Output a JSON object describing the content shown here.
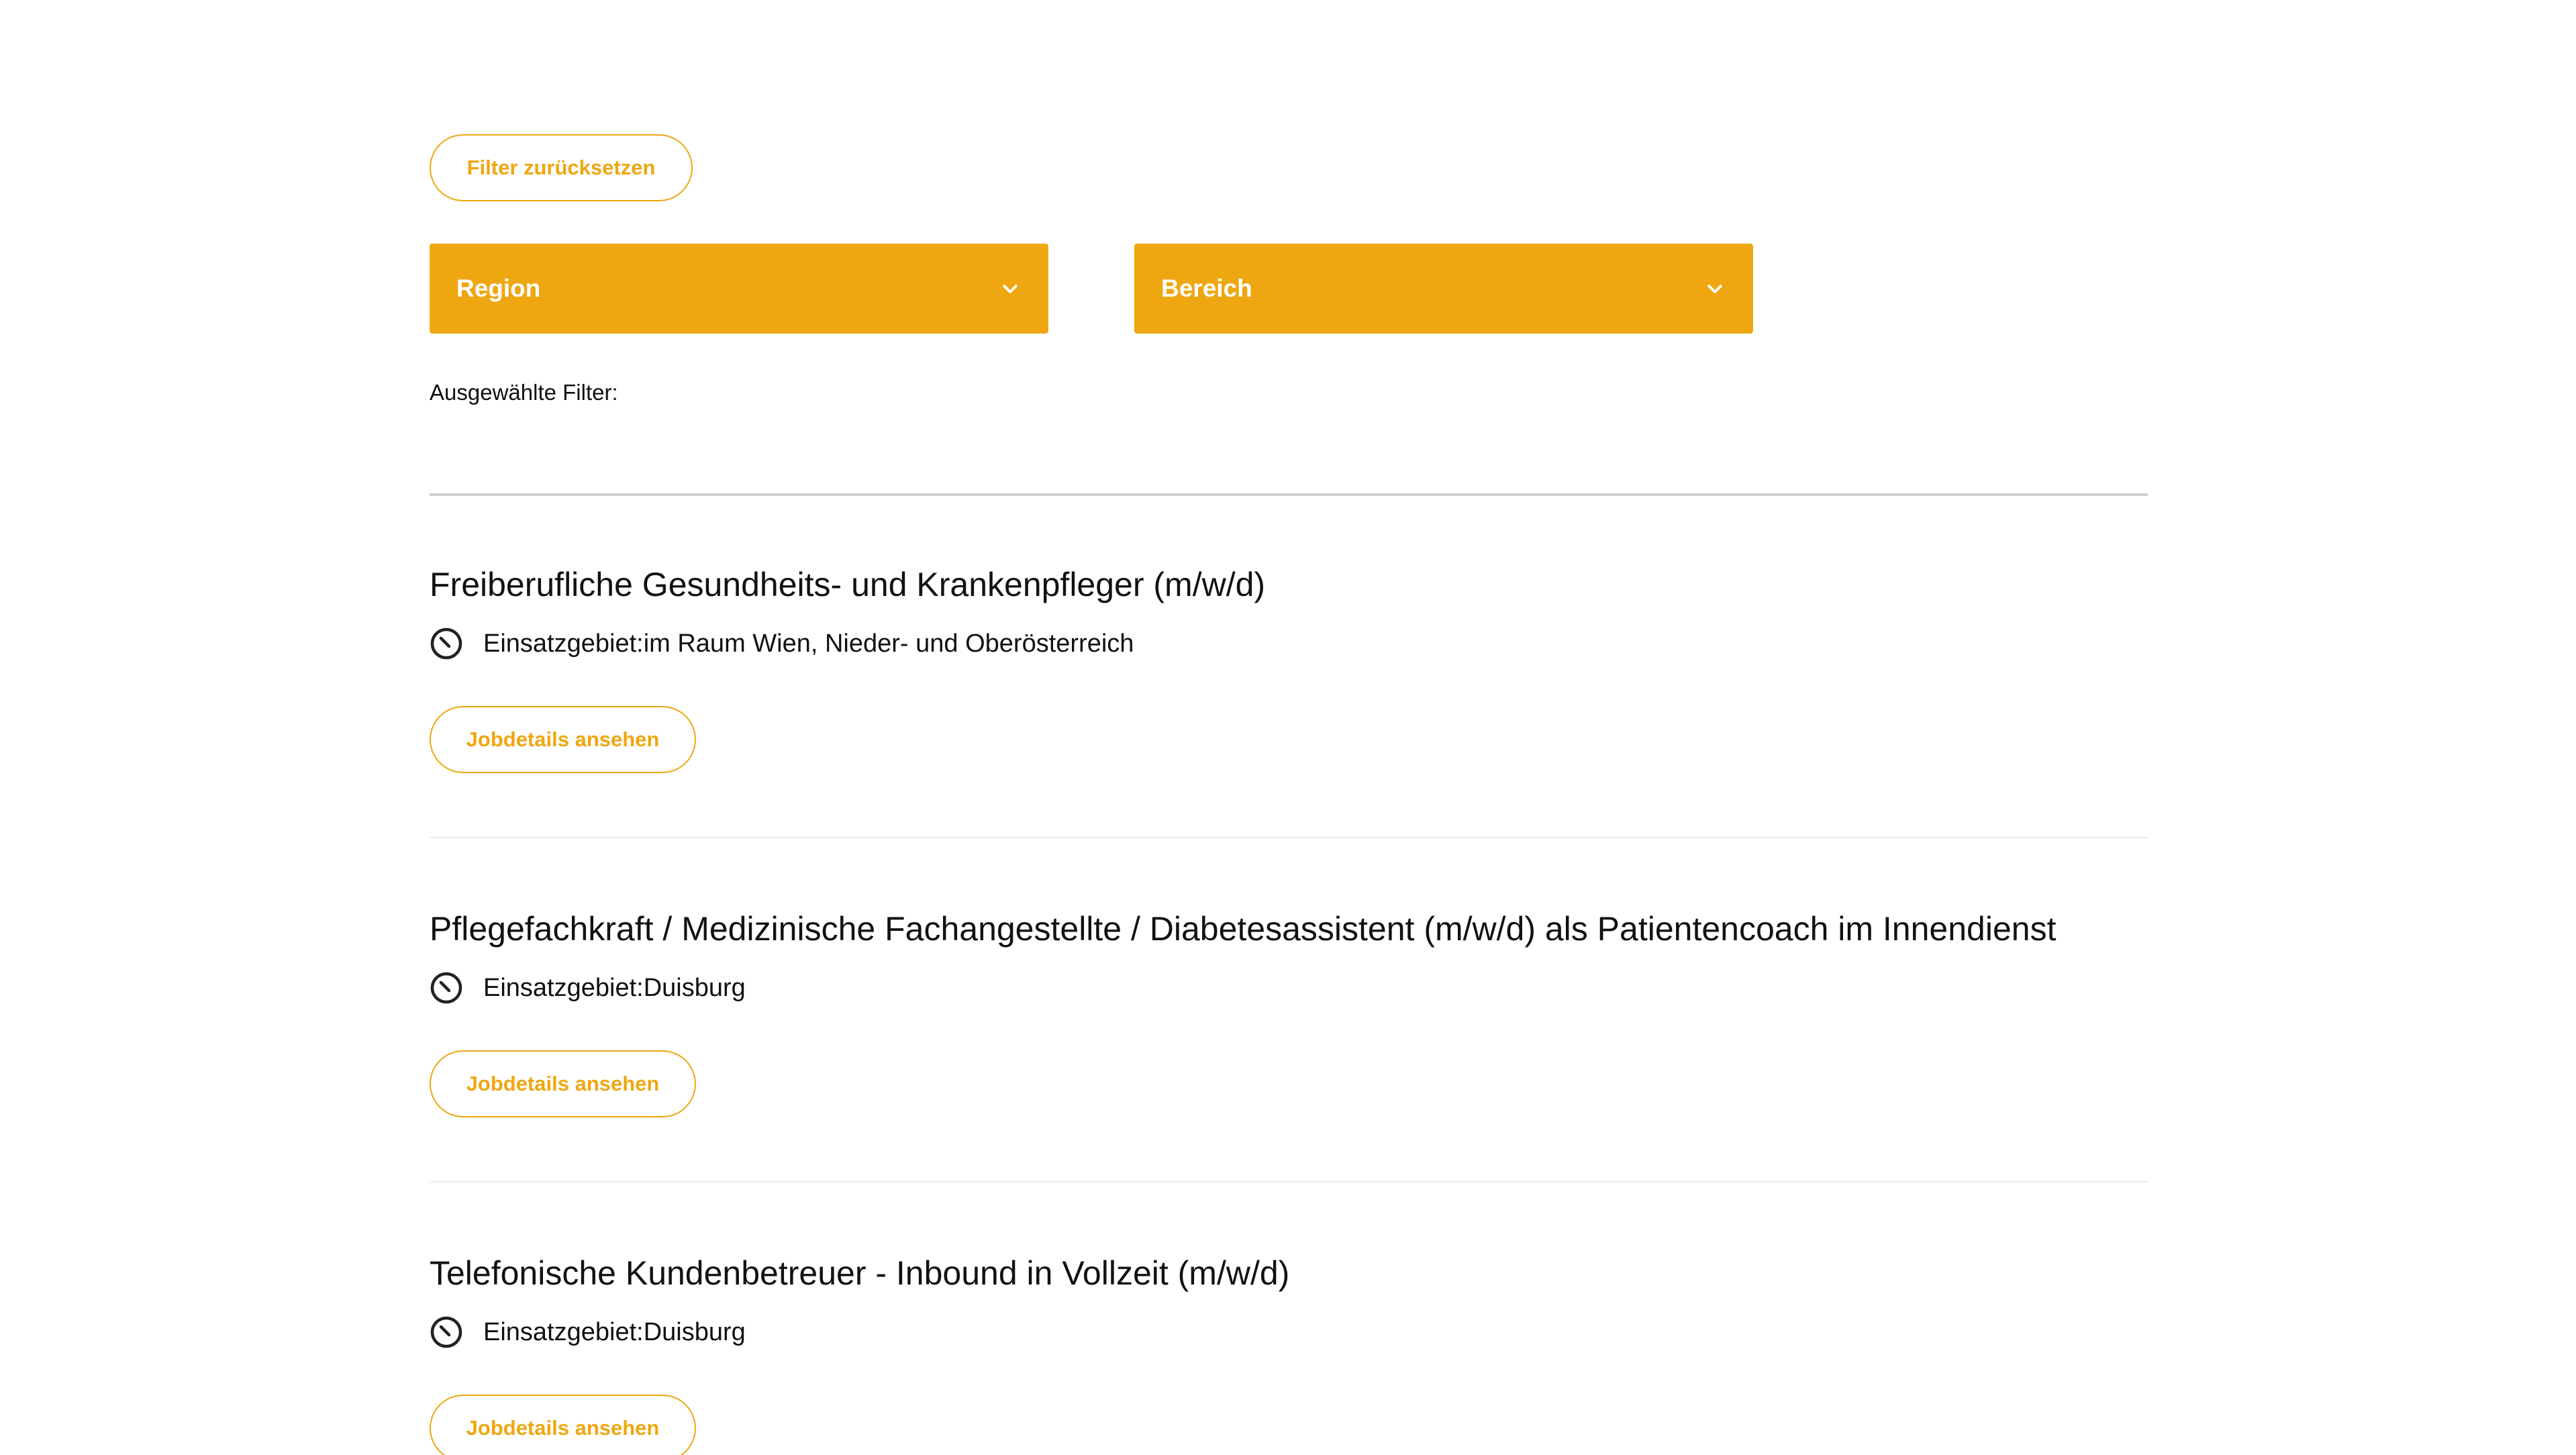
{
  "filters": {
    "reset_label": "Filter zurücksetzen",
    "region_label": "Region",
    "bereich_label": "Bereich",
    "selected_label": "Ausgewählte Filter:"
  },
  "jobs": [
    {
      "title": "Freiberufliche Gesundheits- und Krankenpfleger (m/w/d)",
      "location": "Einsatzgebiet:im Raum Wien, Nieder- und Oberösterreich",
      "button_label": "Jobdetails ansehen"
    },
    {
      "title": "Pflegefachkraft / Medizinische Fachangestellte / Diabetesassistent (m/w/d) als Patientencoach im Innendienst",
      "location": "Einsatzgebiet:Duisburg",
      "button_label": "Jobdetails ansehen"
    },
    {
      "title": "Telefonische Kundenbetreuer - Inbound in Vollzeit (m/w/d)",
      "location": "Einsatzgebiet:Duisburg",
      "button_label": "Jobdetails ansehen"
    }
  ],
  "icons": {
    "dropdown": "chevron-down-icon",
    "location": "clock-icon"
  },
  "colors": {
    "accent": "#efa711",
    "text": "#111111",
    "divider": "#cfcfcf"
  }
}
